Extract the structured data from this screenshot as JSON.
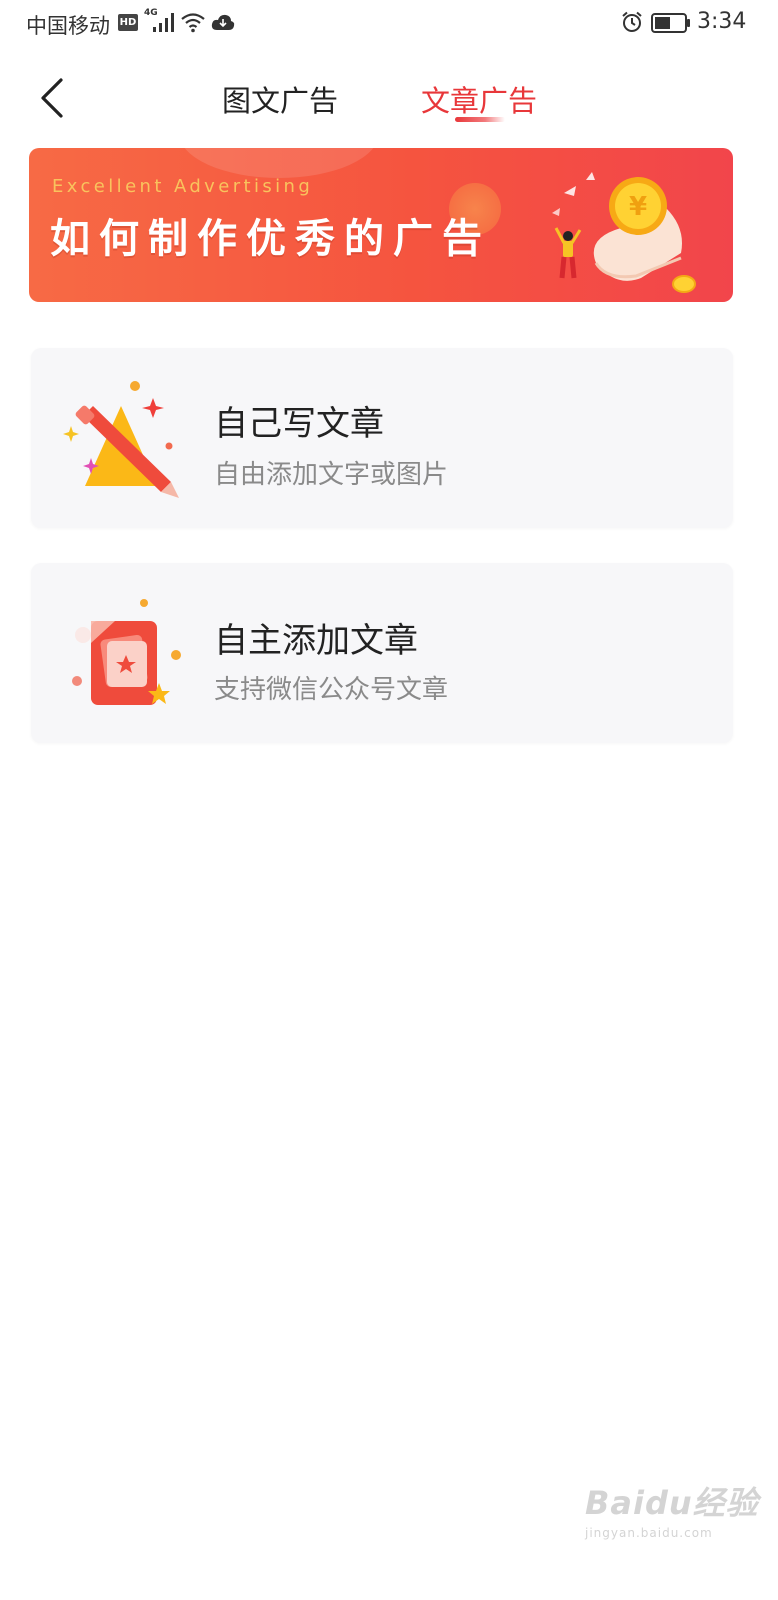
{
  "status_bar": {
    "carrier": "中国移动",
    "hd_badge": "HD",
    "network": "4G",
    "time": "3:34"
  },
  "nav": {
    "back_icon": "chevron-left-icon",
    "tabs": [
      {
        "label": "图文广告",
        "active": false
      },
      {
        "label": "文章广告",
        "active": true
      }
    ],
    "active_color": "#e8373a"
  },
  "banner": {
    "subtitle": "Excellent Advertising",
    "title": "如何制作优秀的广告",
    "gradient_start": "#f76a45",
    "gradient_end": "#f2454b"
  },
  "options": [
    {
      "icon": "pencil-triangle-icon",
      "title": "自己写文章",
      "description": "自由添加文字或图片"
    },
    {
      "icon": "article-card-icon",
      "title": "自主添加文章",
      "description": "支持微信公众号文章"
    }
  ],
  "watermark": {
    "brand": "Baidu经验",
    "url": "jingyan.baidu.com"
  }
}
